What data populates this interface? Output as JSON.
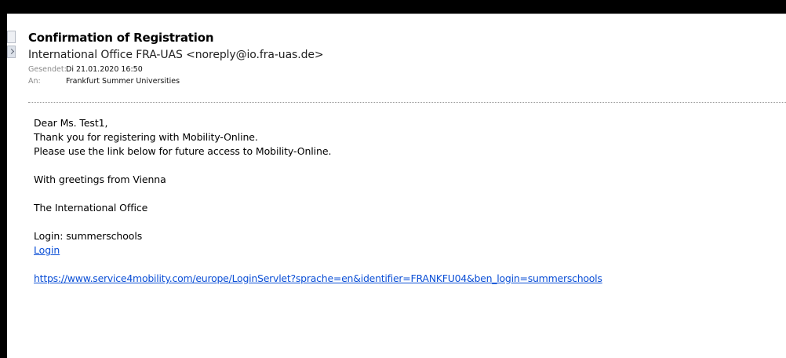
{
  "email": {
    "subject": "Confirmation of Registration",
    "from": "International Office FRA-UAS <noreply@io.fra-uas.de>",
    "sent_label": "Gesendet:",
    "sent_value": "Di 21.01.2020 16:50",
    "to_label": "An:",
    "to_value": "Frankfurt Summer Universities"
  },
  "body": {
    "greeting": "Dear Ms. Test1,",
    "line1": "Thank you for registering with Mobility-Online.",
    "line2": "Please use the link below for future access to Mobility-Online.",
    "closing": "With greetings from Vienna",
    "signature": "The International Office",
    "login_text": "Login: summerschools",
    "login_link": "Login",
    "url": "https://www.service4mobility.com/europe/LoginServlet?sprache=en&identifier=FRANKFU04&ben_login=summerschools"
  },
  "colors": {
    "link": "#0b4fd6",
    "background": "#000000",
    "panel": "#ffffff"
  }
}
